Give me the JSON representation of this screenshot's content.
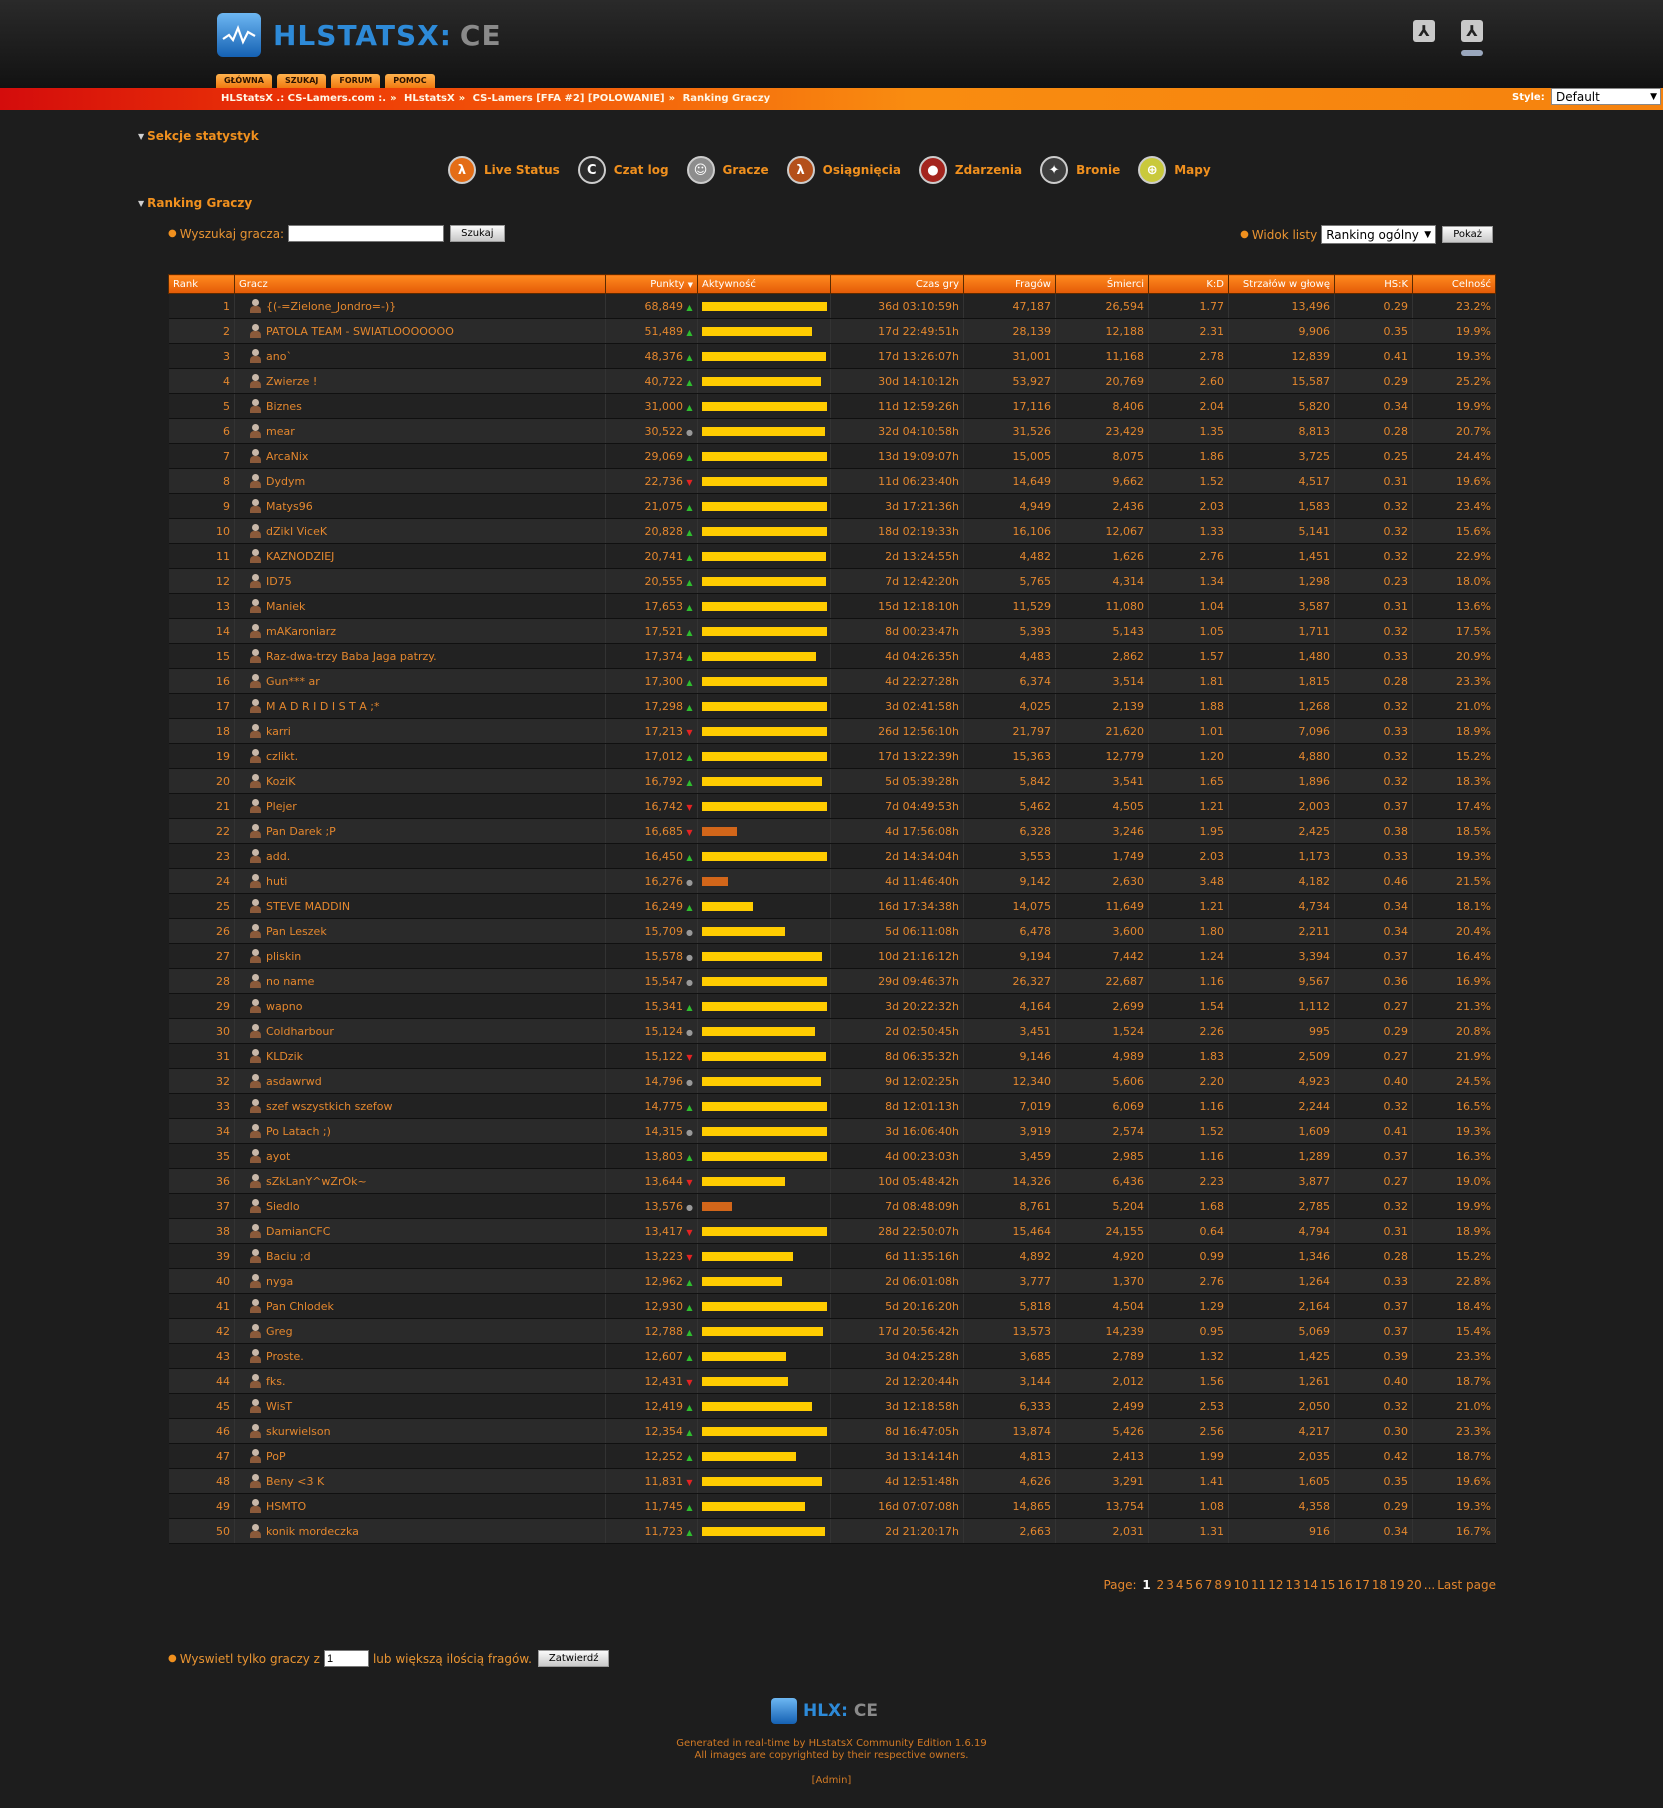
{
  "header": {
    "logo_text": "HLSTATSX:",
    "logo_ce": "CE",
    "tabs": [
      "GŁÓWNA",
      "SZUKAJ",
      "FORUM",
      "POMOC"
    ]
  },
  "breadcrumb": [
    "HLStatsX .: CS-Lamers.com :.",
    "HLstatsX",
    "CS-Lamers [FFA #2] [POLOWANIE]",
    "Ranking Graczy"
  ],
  "style": {
    "label": "Style:",
    "value": "Default"
  },
  "sections": {
    "stats": "Sekcje statystyk",
    "ranking": "Ranking Graczy"
  },
  "nav": [
    {
      "label": "Live Status",
      "icon": "live-status-icon",
      "glyph": "λ",
      "color": "#e46d16"
    },
    {
      "label": "Czat log",
      "icon": "chat-log-icon",
      "glyph": "C",
      "color": "#2b2b2b"
    },
    {
      "label": "Gracze",
      "icon": "players-icon",
      "glyph": "☺",
      "color": "#8d8d8d"
    },
    {
      "label": "Osiągnięcia",
      "icon": "achievements-icon",
      "glyph": "λ",
      "color": "#b4501a"
    },
    {
      "label": "Zdarzenia",
      "icon": "events-icon",
      "glyph": "●",
      "color": "#a4251e"
    },
    {
      "label": "Bronie",
      "icon": "weapons-icon",
      "glyph": "✦",
      "color": "#3d3d3d"
    },
    {
      "label": "Mapy",
      "icon": "maps-icon",
      "glyph": "⊕",
      "color": "#c9c93c"
    }
  ],
  "search": {
    "label": "Wyszukaj gracza:",
    "value": "",
    "button": "Szukaj"
  },
  "list_view": {
    "label": "Widok listy",
    "value": "Ranking ogólny",
    "button": "Pokaż"
  },
  "columns": [
    "Rank",
    "Gracz",
    "Punkty",
    "Aktywność",
    "Czas gry",
    "Fragów",
    "Śmierci",
    "K:D",
    "Strzałów w głowę",
    "HS:K",
    "Celność"
  ],
  "sort_indicator": "▼",
  "players": [
    [
      1,
      "{(-=Zielone_Jondro=-)}",
      "68,849",
      "up",
      1.0,
      "36d 03:10:59h",
      "47,187",
      "26,594",
      "1.77",
      "13,496",
      "0.29",
      "23.2%"
    ],
    [
      2,
      "PATOLA TEAM - SWIATLOOOOOOO",
      "51,489",
      "up",
      0.88,
      "17d 22:49:51h",
      "28,139",
      "12,188",
      "2.31",
      "9,906",
      "0.35",
      "19.9%"
    ],
    [
      3,
      "ano`",
      "48,376",
      "up",
      0.99,
      "17d 13:26:07h",
      "31,001",
      "11,168",
      "2.78",
      "12,839",
      "0.41",
      "19.3%"
    ],
    [
      4,
      "Zwierze !",
      "40,722",
      "up",
      0.95,
      "30d 14:10:12h",
      "53,927",
      "20,769",
      "2.60",
      "15,587",
      "0.29",
      "25.2%"
    ],
    [
      5,
      "Biznes",
      "31,000",
      "up",
      1.0,
      "11d 12:59:26h",
      "17,116",
      "8,406",
      "2.04",
      "5,820",
      "0.34",
      "19.9%"
    ],
    [
      6,
      "mear",
      "30,522",
      "same",
      0.98,
      "32d 04:10:58h",
      "31,526",
      "23,429",
      "1.35",
      "8,813",
      "0.28",
      "20.7%"
    ],
    [
      7,
      "ArcaNix",
      "29,069",
      "up",
      1.0,
      "13d 19:09:07h",
      "15,005",
      "8,075",
      "1.86",
      "3,725",
      "0.25",
      "24.4%"
    ],
    [
      8,
      "Dydym",
      "22,736",
      "down",
      1.0,
      "11d 06:23:40h",
      "14,649",
      "9,662",
      "1.52",
      "4,517",
      "0.31",
      "19.6%"
    ],
    [
      9,
      "Matys96",
      "21,075",
      "up",
      1.0,
      "3d 17:21:36h",
      "4,949",
      "2,436",
      "2.03",
      "1,583",
      "0.32",
      "23.4%"
    ],
    [
      10,
      "dZikI ViceK",
      "20,828",
      "up",
      1.0,
      "18d 02:19:33h",
      "16,106",
      "12,067",
      "1.33",
      "5,141",
      "0.32",
      "15.6%"
    ],
    [
      11,
      "KAZNODZIEJ",
      "20,741",
      "up",
      0.99,
      "2d 13:24:55h",
      "4,482",
      "1,626",
      "2.76",
      "1,451",
      "0.32",
      "22.9%"
    ],
    [
      12,
      "ID75",
      "20,555",
      "up",
      0.99,
      "7d 12:42:20h",
      "5,765",
      "4,314",
      "1.34",
      "1,298",
      "0.23",
      "18.0%"
    ],
    [
      13,
      "Maniek",
      "17,653",
      "up",
      1.0,
      "15d 12:18:10h",
      "11,529",
      "11,080",
      "1.04",
      "3,587",
      "0.31",
      "13.6%"
    ],
    [
      14,
      "mAKaroniarz",
      "17,521",
      "up",
      1.0,
      "8d 00:23:47h",
      "5,393",
      "5,143",
      "1.05",
      "1,711",
      "0.32",
      "17.5%"
    ],
    [
      15,
      "Raz-dwa-trzy Baba Jaga patrzy.",
      "17,374",
      "up",
      0.91,
      "4d 04:26:35h",
      "4,483",
      "2,862",
      "1.57",
      "1,480",
      "0.33",
      "20.9%"
    ],
    [
      16,
      "Gun*** ar",
      "17,300",
      "up",
      1.0,
      "4d 22:27:28h",
      "6,374",
      "3,514",
      "1.81",
      "1,815",
      "0.28",
      "23.3%"
    ],
    [
      17,
      "M A D R I D I S T A ;*",
      "17,298",
      "up",
      1.0,
      "3d 02:41:58h",
      "4,025",
      "2,139",
      "1.88",
      "1,268",
      "0.32",
      "21.0%"
    ],
    [
      18,
      "karri",
      "17,213",
      "down",
      1.0,
      "26d 12:56:10h",
      "21,797",
      "21,620",
      "1.01",
      "7,096",
      "0.33",
      "18.9%"
    ],
    [
      19,
      "czlikt.",
      "17,012",
      "up",
      1.0,
      "17d 13:22:39h",
      "15,363",
      "12,779",
      "1.20",
      "4,880",
      "0.32",
      "15.2%"
    ],
    [
      20,
      "KoziK",
      "16,792",
      "up",
      0.96,
      "5d 05:39:28h",
      "5,842",
      "3,541",
      "1.65",
      "1,896",
      "0.32",
      "18.3%"
    ],
    [
      21,
      "Plejer",
      "16,742",
      "down",
      1.0,
      "7d 04:49:53h",
      "5,462",
      "4,505",
      "1.21",
      "2,003",
      "0.37",
      "17.4%"
    ],
    [
      22,
      "Pan Darek ;P",
      "16,685",
      "down",
      0.28,
      "4d 17:56:08h",
      "6,328",
      "3,246",
      "1.95",
      "2,425",
      "0.38",
      "18.5%"
    ],
    [
      23,
      "add.",
      "16,450",
      "up",
      1.0,
      "2d 14:34:04h",
      "3,553",
      "1,749",
      "2.03",
      "1,173",
      "0.33",
      "19.3%"
    ],
    [
      24,
      "huti",
      "16,276",
      "same",
      0.21,
      "4d 11:46:40h",
      "9,142",
      "2,630",
      "3.48",
      "4,182",
      "0.46",
      "21.5%"
    ],
    [
      25,
      "STEVE MADDIN",
      "16,249",
      "up",
      0.41,
      "16d 17:34:38h",
      "14,075",
      "11,649",
      "1.21",
      "4,734",
      "0.34",
      "18.1%"
    ],
    [
      26,
      "Pan Leszek",
      "15,709",
      "same",
      0.66,
      "5d 06:11:08h",
      "6,478",
      "3,600",
      "1.80",
      "2,211",
      "0.34",
      "20.4%"
    ],
    [
      27,
      "pliskin",
      "15,578",
      "same",
      0.96,
      "10d 21:16:12h",
      "9,194",
      "7,442",
      "1.24",
      "3,394",
      "0.37",
      "16.4%"
    ],
    [
      28,
      "no name",
      "15,547",
      "same",
      1.0,
      "29d 09:46:37h",
      "26,327",
      "22,687",
      "1.16",
      "9,567",
      "0.36",
      "16.9%"
    ],
    [
      29,
      "wapno",
      "15,341",
      "up",
      1.0,
      "3d 20:22:32h",
      "4,164",
      "2,699",
      "1.54",
      "1,112",
      "0.27",
      "21.3%"
    ],
    [
      30,
      "Coldharbour",
      "15,124",
      "same",
      0.9,
      "2d 02:50:45h",
      "3,451",
      "1,524",
      "2.26",
      "995",
      "0.29",
      "20.8%"
    ],
    [
      31,
      "KLDzik",
      "15,122",
      "down",
      0.99,
      "8d 06:35:32h",
      "9,146",
      "4,989",
      "1.83",
      "2,509",
      "0.27",
      "21.9%"
    ],
    [
      32,
      "asdawrwd",
      "14,796",
      "same",
      0.95,
      "9d 12:02:25h",
      "12,340",
      "5,606",
      "2.20",
      "4,923",
      "0.40",
      "24.5%"
    ],
    [
      33,
      "szef wszystkich szefow",
      "14,775",
      "up",
      1.0,
      "8d 12:01:13h",
      "7,019",
      "6,069",
      "1.16",
      "2,244",
      "0.32",
      "16.5%"
    ],
    [
      34,
      "Po Latach ;)",
      "14,315",
      "same",
      1.0,
      "3d 16:06:40h",
      "3,919",
      "2,574",
      "1.52",
      "1,609",
      "0.41",
      "19.3%"
    ],
    [
      35,
      "ayot",
      "13,803",
      "up",
      1.0,
      "4d 00:23:03h",
      "3,459",
      "2,985",
      "1.16",
      "1,289",
      "0.37",
      "16.3%"
    ],
    [
      36,
      "sZkLanY^wZrOk~",
      "13,644",
      "down",
      0.66,
      "10d 05:48:42h",
      "14,326",
      "6,436",
      "2.23",
      "3,877",
      "0.27",
      "19.0%"
    ],
    [
      37,
      "Siedlo",
      "13,576",
      "same",
      0.24,
      "7d 08:48:09h",
      "8,761",
      "5,204",
      "1.68",
      "2,785",
      "0.32",
      "19.9%"
    ],
    [
      38,
      "DamianCFC",
      "13,417",
      "down",
      1.0,
      "28d 22:50:07h",
      "15,464",
      "24,155",
      "0.64",
      "4,794",
      "0.31",
      "18.9%"
    ],
    [
      39,
      "Baciu ;d",
      "13,223",
      "down",
      0.73,
      "6d 11:35:16h",
      "4,892",
      "4,920",
      "0.99",
      "1,346",
      "0.28",
      "15.2%"
    ],
    [
      40,
      "nyga",
      "12,962",
      "up",
      0.64,
      "2d 06:01:08h",
      "3,777",
      "1,370",
      "2.76",
      "1,264",
      "0.33",
      "22.8%"
    ],
    [
      41,
      "Pan Chlodek",
      "12,930",
      "up",
      1.0,
      "5d 20:16:20h",
      "5,818",
      "4,504",
      "1.29",
      "2,164",
      "0.37",
      "18.4%"
    ],
    [
      42,
      "Greg",
      "12,788",
      "up",
      0.97,
      "17d 20:56:42h",
      "13,573",
      "14,239",
      "0.95",
      "5,069",
      "0.37",
      "15.4%"
    ],
    [
      43,
      "Proste.",
      "12,607",
      "up",
      0.67,
      "3d 04:25:28h",
      "3,685",
      "2,789",
      "1.32",
      "1,425",
      "0.39",
      "23.3%"
    ],
    [
      44,
      "fks.",
      "12,431",
      "down",
      0.69,
      "2d 12:20:44h",
      "3,144",
      "2,012",
      "1.56",
      "1,261",
      "0.40",
      "18.7%"
    ],
    [
      45,
      "WisT",
      "12,419",
      "up",
      0.88,
      "3d 12:18:58h",
      "6,333",
      "2,499",
      "2.53",
      "2,050",
      "0.32",
      "21.0%"
    ],
    [
      46,
      "skurwielson",
      "12,354",
      "up",
      1.0,
      "8d 16:47:05h",
      "13,874",
      "5,426",
      "2.56",
      "4,217",
      "0.30",
      "23.3%"
    ],
    [
      47,
      "PoP",
      "12,252",
      "up",
      0.75,
      "3d 13:14:14h",
      "4,813",
      "2,413",
      "1.99",
      "2,035",
      "0.42",
      "18.7%"
    ],
    [
      48,
      "Beny <3 K",
      "11,831",
      "down",
      0.96,
      "4d 12:51:48h",
      "4,626",
      "3,291",
      "1.41",
      "1,605",
      "0.35",
      "19.6%"
    ],
    [
      49,
      "HSMTO",
      "11,745",
      "up",
      0.82,
      "16d 07:07:08h",
      "14,865",
      "13,754",
      "1.08",
      "4,358",
      "0.29",
      "19.3%"
    ],
    [
      50,
      "konik mordeczka",
      "11,723",
      "up",
      0.98,
      "2d 21:20:17h",
      "2,663",
      "2,031",
      "1.31",
      "916",
      "0.34",
      "16.7%"
    ]
  ],
  "pager": {
    "label": "Page:",
    "current": "1",
    "pages": [
      "2",
      "3",
      "4",
      "5",
      "6",
      "7",
      "8",
      "9",
      "10",
      "11",
      "12",
      "13",
      "14",
      "15",
      "16",
      "17",
      "18",
      "19",
      "20"
    ],
    "ellipsis": "...",
    "last": "Last page"
  },
  "filter": {
    "prefix": "Wyswietl tylko graczy z",
    "value": "1",
    "suffix": "lub większą ilością fragów.",
    "button": "Zatwierdź"
  },
  "footer": {
    "logo_text": "HLX:",
    "logo_ce": "CE",
    "line1": "Generated in real-time by HLstatsX Community Edition 1.6.19",
    "line2": "All images are copyrighted by their respective owners.",
    "admin": "[Admin]"
  },
  "colors": {
    "accent": "#f0901e",
    "bar_full": "#ffcc00",
    "bar_low": "#d2661a"
  }
}
